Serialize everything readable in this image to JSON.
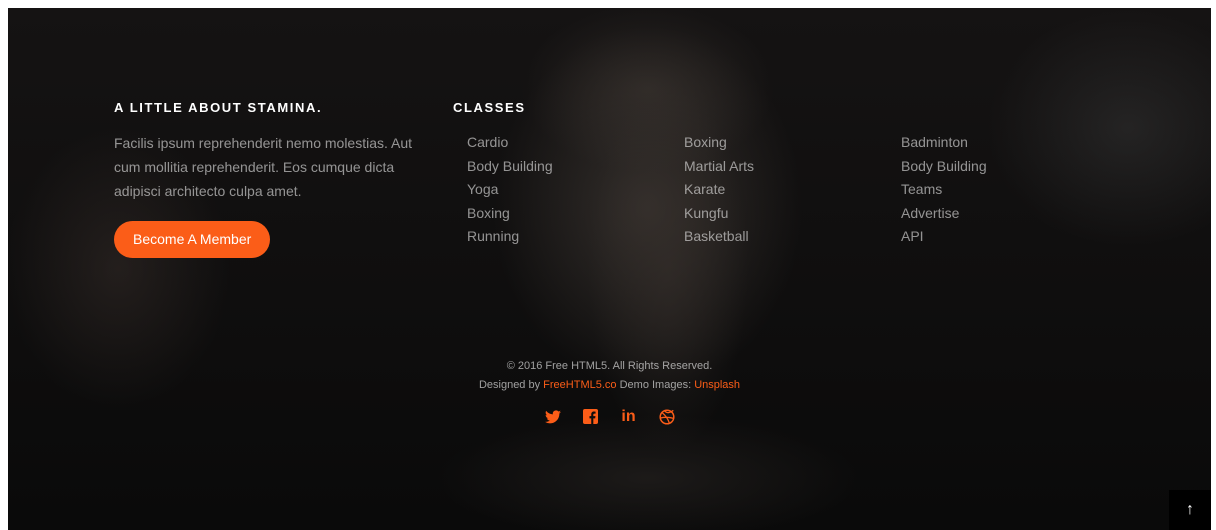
{
  "about": {
    "heading": "A LITTLE ABOUT STAMINA.",
    "text": "Facilis ipsum reprehenderit nemo molestias. Aut cum mollitia reprehenderit. Eos cumque dicta adipisci architecto culpa amet.",
    "cta_label": "Become A Member"
  },
  "classes": {
    "heading": "CLASSES",
    "columns": [
      [
        "Cardio",
        "Body Building",
        "Yoga",
        "Boxing",
        "Running"
      ],
      [
        "Boxing",
        "Martial Arts",
        "Karate",
        "Kungfu",
        "Basketball"
      ],
      [
        "Badminton",
        "Body Building",
        "Teams",
        "Advertise",
        "API"
      ]
    ]
  },
  "footer": {
    "copyright": "© 2016 Free HTML5. All Rights Reserved.",
    "designed_by_prefix": "Designed by",
    "designer_link": "FreeHTML5.co",
    "images_prefix": "Demo Images:",
    "images_link": "Unsplash"
  },
  "social": {
    "twitter_icon": "twitter-icon",
    "facebook_icon": "facebook-icon",
    "linkedin_icon": "linkedin-icon",
    "dribbble_icon": "dribbble-icon",
    "linkedin_glyph": "in"
  },
  "back_to_top": "↑",
  "colors": {
    "accent": "#fb5d18",
    "background": "#0d0d0d",
    "text_muted": "rgba(255,255,255,0.55)"
  }
}
